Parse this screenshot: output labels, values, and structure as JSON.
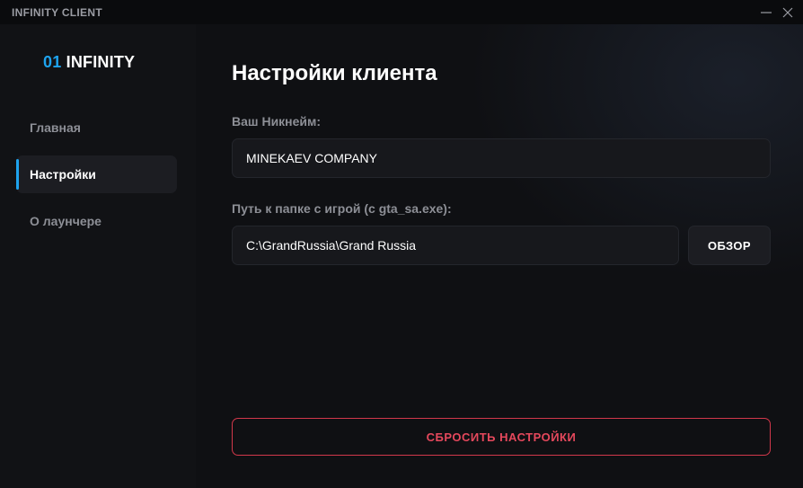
{
  "window": {
    "title": "INFINITY CLIENT"
  },
  "sidebar": {
    "logo": {
      "number": "01",
      "word": "INFINITY"
    },
    "items": [
      {
        "label": "Главная"
      },
      {
        "label": "Настройки"
      },
      {
        "label": "О лаунчере"
      }
    ],
    "active_index": 1
  },
  "settings": {
    "title": "Настройки клиента",
    "nickname": {
      "label": "Ваш Никнейм:",
      "value": "MINEKAEV COMPANY"
    },
    "game_path": {
      "label": "Путь к папке с игрой (с gta_sa.exe):",
      "value": "C:\\GrandRussia\\Grand Russia",
      "browse_label": "ОБЗОР"
    },
    "reset_label": "СБРОСИТЬ НАСТРОЙКИ"
  },
  "colors": {
    "accent": "#1ea3ee",
    "danger": "#d2384b",
    "background": "#0f1013",
    "sidebar": "#111215"
  },
  "icons": {
    "minimize": "minimize-icon",
    "close": "close-icon"
  }
}
